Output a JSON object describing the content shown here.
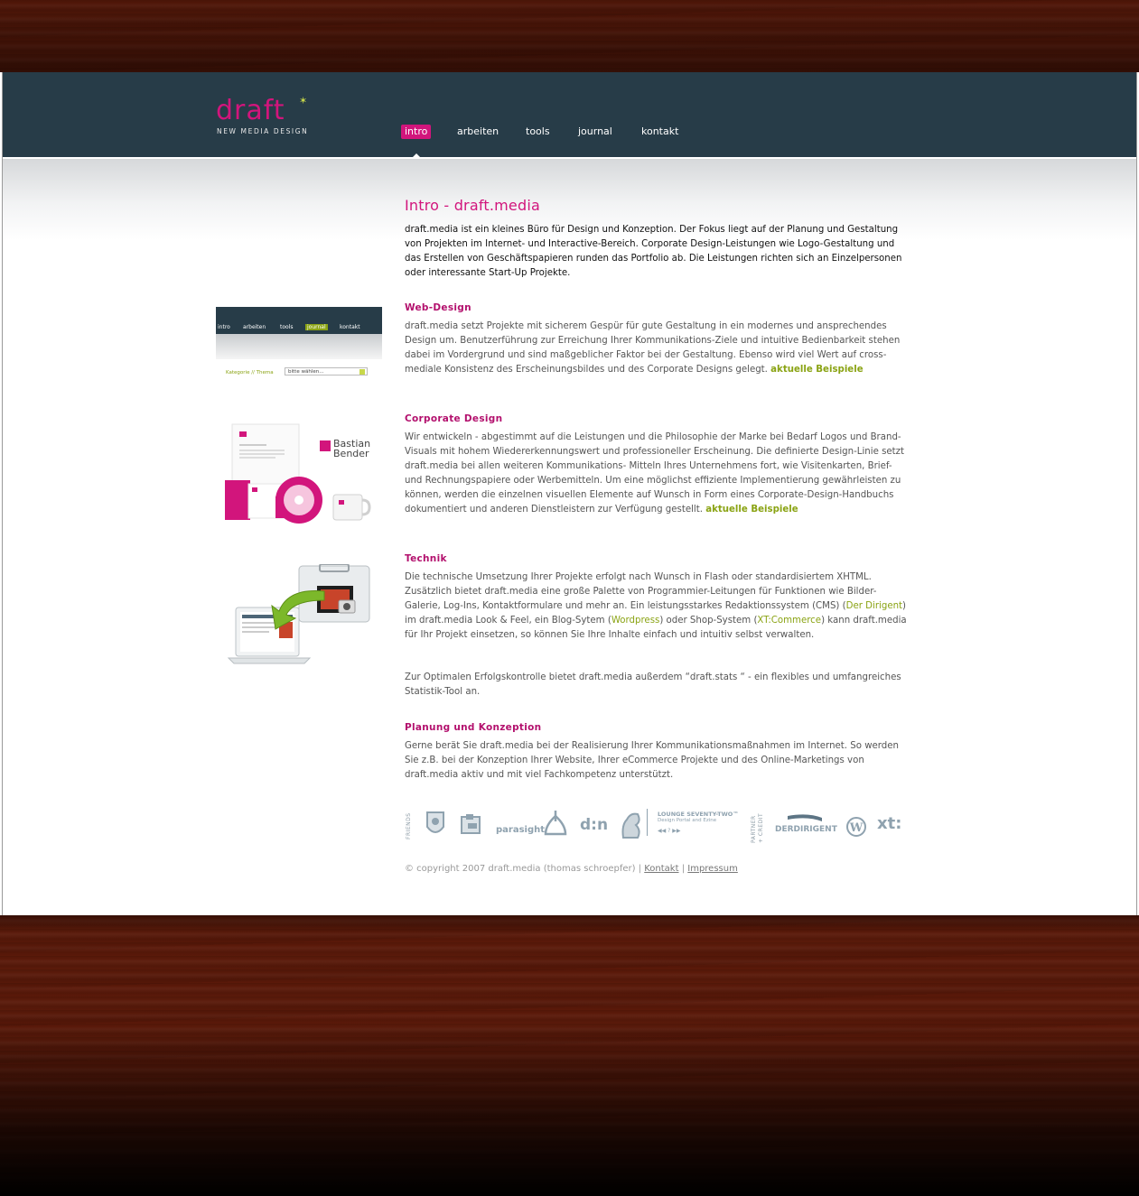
{
  "brand": {
    "logo_word": "draft",
    "logo_sub": "NEW MEDIA DESIGN"
  },
  "nav": {
    "items": [
      "intro",
      "arbeiten",
      "tools",
      "journal",
      "kontakt"
    ],
    "active": "intro"
  },
  "page": {
    "title": "Intro - draft.media",
    "intro": "draft.media ist ein kleines Büro für Design und Konzeption. Der Fokus liegt auf der Planung und Gestaltung von Projekten im Internet- und Interactive-Bereich. Corporate Design-Leistungen wie Logo-Gestaltung und das Erstellen von Geschäftspapieren runden das Portfolio ab. Die Leistungen richten sich an Einzelpersonen oder interessante Start-Up Projekte."
  },
  "sections": {
    "web": {
      "title": "Web-Design",
      "text": "draft.media setzt Projekte mit sicherem Gespür für gute Gestaltung in ein modernes und ansprechendes Design um. Benutzerführung zur Erreichung Ihrer Kommunikations-Ziele und intuitive Bedienbarkeit stehen dabei im Vordergrund und sind maßgeblicher Faktor bei der Gestaltung. Ebenso wird viel Wert auf cross-mediale Konsistenz des Erscheinungsbildes und des Corporate Designs gelegt.",
      "link": "aktuelle Beispiele"
    },
    "cd": {
      "title": "Corporate Design",
      "text": "Wir entwickeln - abgestimmt auf die Leistungen und die Philosophie der Marke bei Bedarf Logos und Brand-Visuals mit hohem Wiedererkennungswert und professioneller Erscheinung. Die definierte Design-Linie setzt draft.media bei allen weiteren Kommunikations- Mitteln Ihres Unternehmens fort, wie Visitenkarten, Brief- und Rechnungspapiere oder Werbemitteln. Um eine möglichst effiziente Implementierung gewährleisten zu können, werden die einzelnen visuellen Elemente auf Wunsch in Form eines Corporate-Design-Handbuchs dokumentiert und anderen Dienstleistern zur Verfügung gestellt.",
      "link": "aktuelle Beispiele"
    },
    "tech": {
      "title": "Technik",
      "p1_a": "Die technische Umsetzung Ihrer Projekte erfolgt nach Wunsch in Flash oder standardisiertem XHTML. Zusätzlich bietet draft.media eine große Palette von Programmier-Leitungen für Funktionen wie Bilder-Galerie, Log-Ins, Kontaktformulare und mehr an. Ein leistungsstarkes Redaktionssystem (CMS) (",
      "link_dirigent": "Der Dirigent",
      "p1_b": ") im draft.media Look & Feel, ein Blog-Sytem (",
      "link_wordpress": "Wordpress",
      "p1_c": ") oder Shop-System (",
      "link_xt": "XT:Commerce",
      "p1_d": ") kann draft.media für Ihr Projekt einsetzen, so können Sie Ihre Inhalte einfach und intuitiv selbst verwalten.",
      "p2": "Zur Optimalen Erfolgskontrolle bietet draft.media außerdem  “draft.stats “ - ein flexibles und umfangreiches Statistik-Tool an."
    },
    "plan": {
      "title": "Planung und Konzeption",
      "text": "Gerne berät Sie draft.media bei der Realisierung Ihrer Kommunikationsmaßnahmen im Internet. So werden Sie z.B. bei der Konzeption Ihrer Website, Ihrer eCommerce Projekte und des Online-Marketings von draft.media aktiv und mit viel Fachkompetenz unterstützt."
    }
  },
  "thumb_web": {
    "nav": [
      "intro",
      "arbeiten",
      "tools",
      "journal",
      "kontakt"
    ],
    "kategorie": "Kategorie // Thema",
    "select": "bitte wählen..."
  },
  "thumb_cd": {
    "brand_line1": "Bastian",
    "brand_line2": "Bender"
  },
  "badges": {
    "friends_label": "FRIENDS",
    "partner_label1": "PARTNER",
    "partner_label2": "+ CREDIT",
    "parasight": "parasight",
    "dn": "d:n",
    "lounge_title": "LOUNGE SEVENTY-TWO™",
    "lounge_sub": "Design Portal and Ezine",
    "lounge_nav": "◀◀      ?      ▶▶",
    "derdirigent": "DERDIRIGENT",
    "xt": "xt:"
  },
  "footer": {
    "copyright": "© copyright 2007 draft.media (thomas schroepfer) | ",
    "sep": " | ",
    "kontakt": "Kontakt",
    "impressum": "Impressum"
  },
  "colors": {
    "brand_pink": "#d2157c",
    "accent_green": "#8aa313",
    "header_bg": "#273c48"
  }
}
